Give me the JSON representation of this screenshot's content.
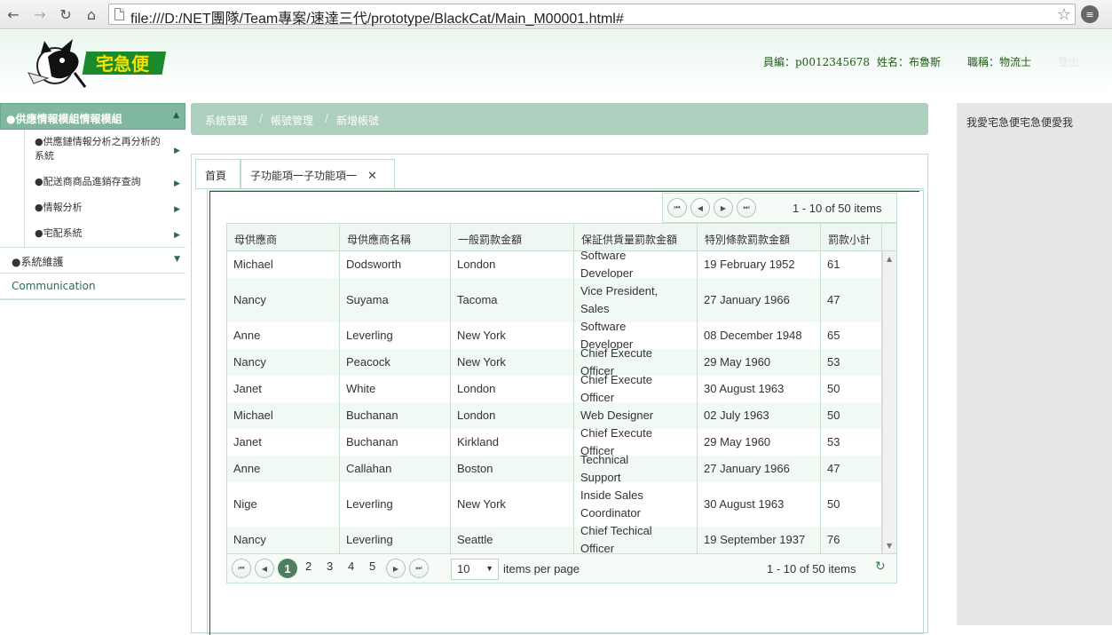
{
  "browser": {
    "url": "file:///D:/NET團隊/Team專案/速達三代/prototype/BlackCat/Main_M00001.html#"
  },
  "header": {
    "logo_text": "宅急便",
    "employee_id": "員編：p0012345678",
    "name": "姓名：布魯斯",
    "title": "職稱：物流士",
    "logout": "登出"
  },
  "sidebar": {
    "group_label": "●供應情報模組情報模組",
    "sub_items": [
      {
        "label": "●供應鏈情報分析之再分析的系統"
      },
      {
        "label": "●配送商商品進銷存查詢"
      },
      {
        "label": "●情報分析"
      },
      {
        "label": "●宅配系統"
      }
    ],
    "system_label": "●系統維護",
    "communication": "Communication"
  },
  "breadcrumb": [
    "系統管理",
    "帳號管理",
    "新增帳號"
  ],
  "tabs": [
    {
      "label": "首頁"
    },
    {
      "label": "子功能項一子功能項一"
    }
  ],
  "grid": {
    "pager_top_info": "1 - 10 of 50 items",
    "columns": [
      "母供應商",
      "母供應商名稱",
      "一般罰款金額",
      "保証供貨量罰款金額",
      "特別條款罰款金額",
      "罰款小計"
    ],
    "rows": [
      [
        "Michael",
        "Dodsworth",
        "London",
        "Software Developer",
        "19 February 1952",
        "61"
      ],
      [
        "Nancy",
        "Suyama",
        "Tacoma",
        "Vice President, Sales",
        "27 January 1966",
        "47"
      ],
      [
        "Anne",
        "Leverling",
        "New York",
        "Software Developer",
        "08 December 1948",
        "65"
      ],
      [
        "Nancy",
        "Peacock",
        "New York",
        "Chief Execute Officer",
        "29 May 1960",
        "53"
      ],
      [
        "Janet",
        "White",
        "London",
        "Chief Execute Officer",
        "30 August 1963",
        "50"
      ],
      [
        "Michael",
        "Buchanan",
        "London",
        "Web Designer",
        "02 July 1963",
        "50"
      ],
      [
        "Janet",
        "Buchanan",
        "Kirkland",
        "Chief Execute Officer",
        "29 May 1960",
        "53"
      ],
      [
        "Anne",
        "Callahan",
        "Boston",
        "Technical Support",
        "27 January 1966",
        "47"
      ],
      [
        "Nige",
        "Leverling",
        "New York",
        "Inside Sales Coordinator",
        "30 August 1963",
        "50"
      ],
      [
        "Nancy",
        "Leverling",
        "Seattle",
        "Chief Techical Officer",
        "19 September 1937",
        "76"
      ]
    ],
    "pages": [
      "1",
      "2",
      "3",
      "4",
      "5"
    ],
    "page_size": "10",
    "items_per_page": "items per page",
    "pager_bottom_info": "1 - 10 of 50 items"
  },
  "right_panel": {
    "text": "我愛宅急便宅急便愛我"
  }
}
